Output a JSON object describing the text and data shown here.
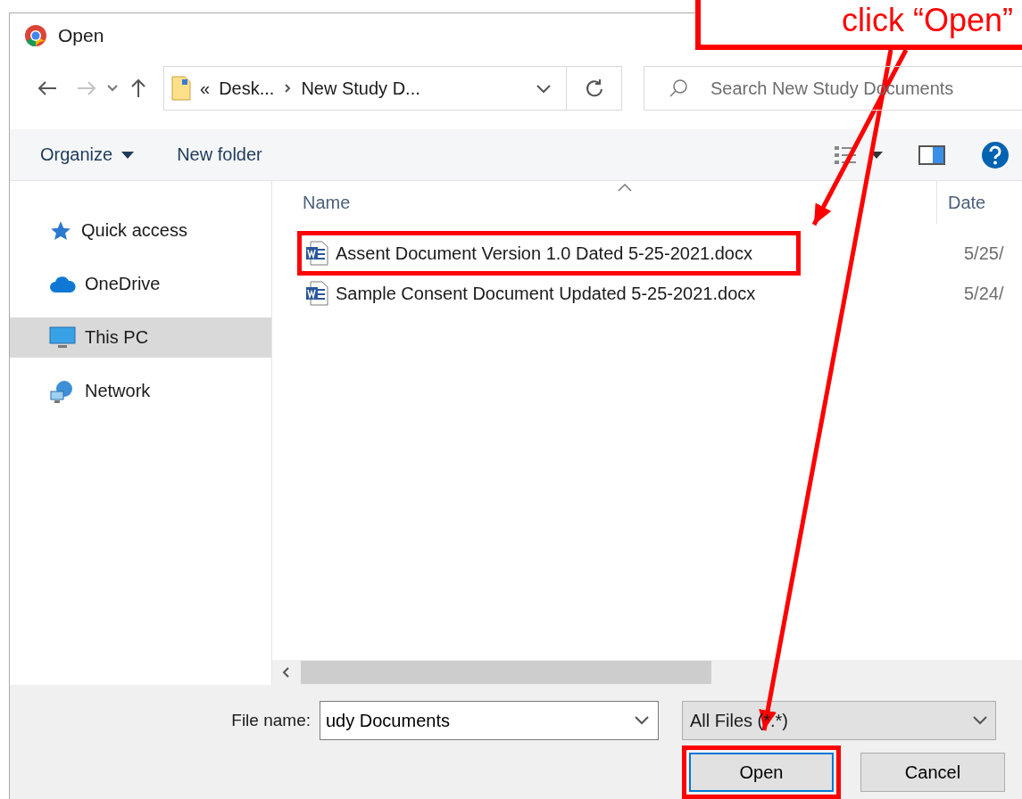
{
  "window": {
    "title": "Open"
  },
  "nav": {
    "overflow_mark": "«",
    "path": [
      "Desk...",
      "New Study D..."
    ],
    "search": {
      "placeholder": "Search New Study Documents"
    }
  },
  "toolbar": {
    "organize": "Organize",
    "new_folder": "New folder"
  },
  "sidebar": {
    "items": [
      {
        "label": "Quick access",
        "kind": "star",
        "selected": false
      },
      {
        "label": "OneDrive",
        "kind": "cloud",
        "selected": false
      },
      {
        "label": "This PC",
        "kind": "pc",
        "selected": true
      },
      {
        "label": "Network",
        "kind": "network",
        "selected": false
      }
    ]
  },
  "table": {
    "columns": [
      "Name",
      "Date"
    ],
    "rows": [
      {
        "name": "Assent Document Version 1.0 Dated 5-25-2021.docx",
        "date": "5/25/",
        "highlighted": true
      },
      {
        "name": "Sample Consent Document Updated 5-25-2021.docx",
        "date": "5/24/",
        "highlighted": false
      }
    ]
  },
  "footer": {
    "file_name_label": "File name:",
    "file_name_value": "udy Documents",
    "filter": "All Files (*.*)",
    "buttons": [
      {
        "label": "Open",
        "default": true,
        "highlighted": true
      },
      {
        "label": "Cancel",
        "default": false,
        "highlighted": false
      }
    ]
  },
  "annotation": {
    "callout": "click “Open”"
  }
}
